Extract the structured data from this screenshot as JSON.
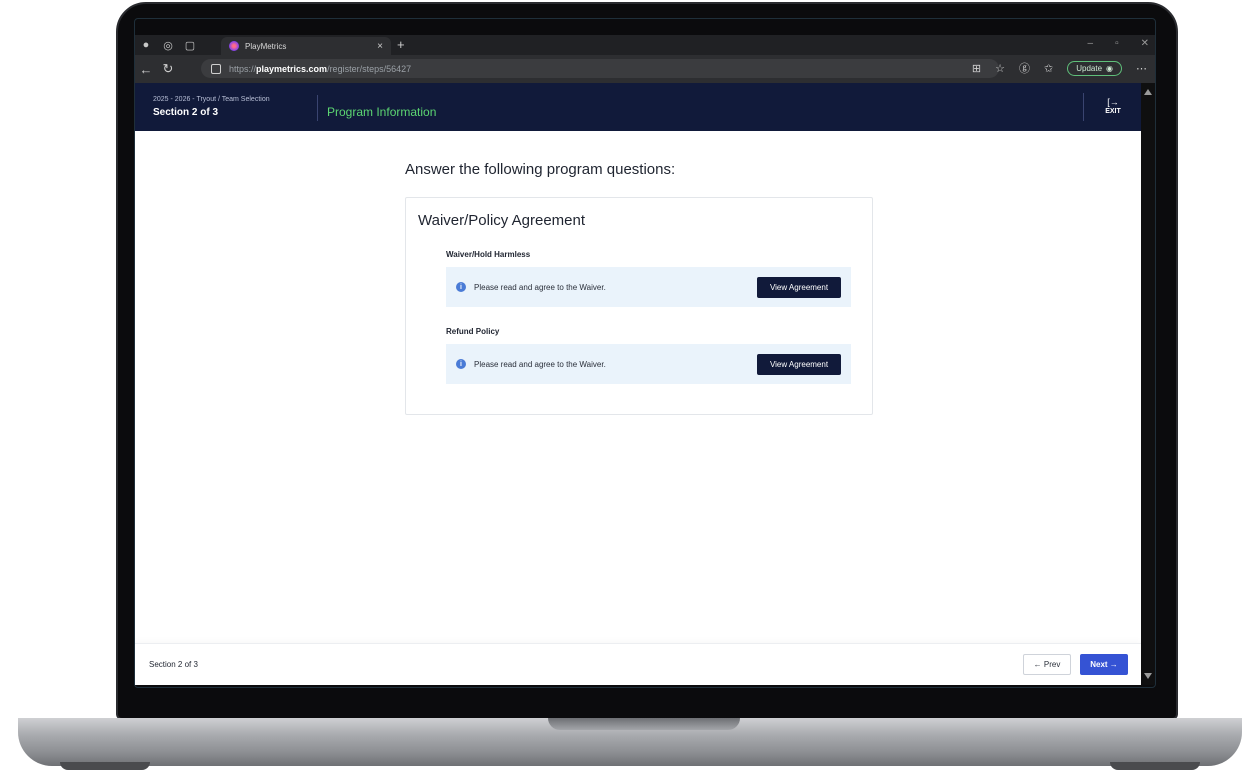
{
  "browser": {
    "tab_title": "PlayMetrics",
    "tab_close": "×",
    "new_tab": "+",
    "url_prefix": "https://",
    "url_host": "playmetrics.com",
    "url_path": "/register/steps/56427",
    "update_label": "Update",
    "icons": [
      "profile-icon",
      "workspaces-icon",
      "tab-actions-icon",
      "back-icon",
      "refresh-icon",
      "lock-icon",
      "apps-icon",
      "star-icon",
      "extensions-icon",
      "favorites-icon",
      "more-icon"
    ]
  },
  "header": {
    "breadcrumb": "2025 - 2026 - Tryout / Team Selection",
    "section": "Section 2 of 3",
    "title": "Program Information",
    "exit_label": "EXIT",
    "colors": {
      "background": "#111a3a",
      "title": "#5cd672"
    }
  },
  "main": {
    "question_heading": "Answer the following program questions:",
    "card": {
      "title": "Waiver/Policy Agreement",
      "items": [
        {
          "label": "Waiver/Hold Harmless",
          "message": "Please read and agree to the Waiver.",
          "button": "View Agreement"
        },
        {
          "label": "Refund Policy",
          "message": "Please read and agree to the Waiver.",
          "button": "View Agreement"
        }
      ]
    }
  },
  "footer": {
    "section": "Section 2 of 3",
    "prev_label": "← Prev",
    "next_label": "Next →",
    "colors": {
      "next": "#3553d4"
    }
  }
}
